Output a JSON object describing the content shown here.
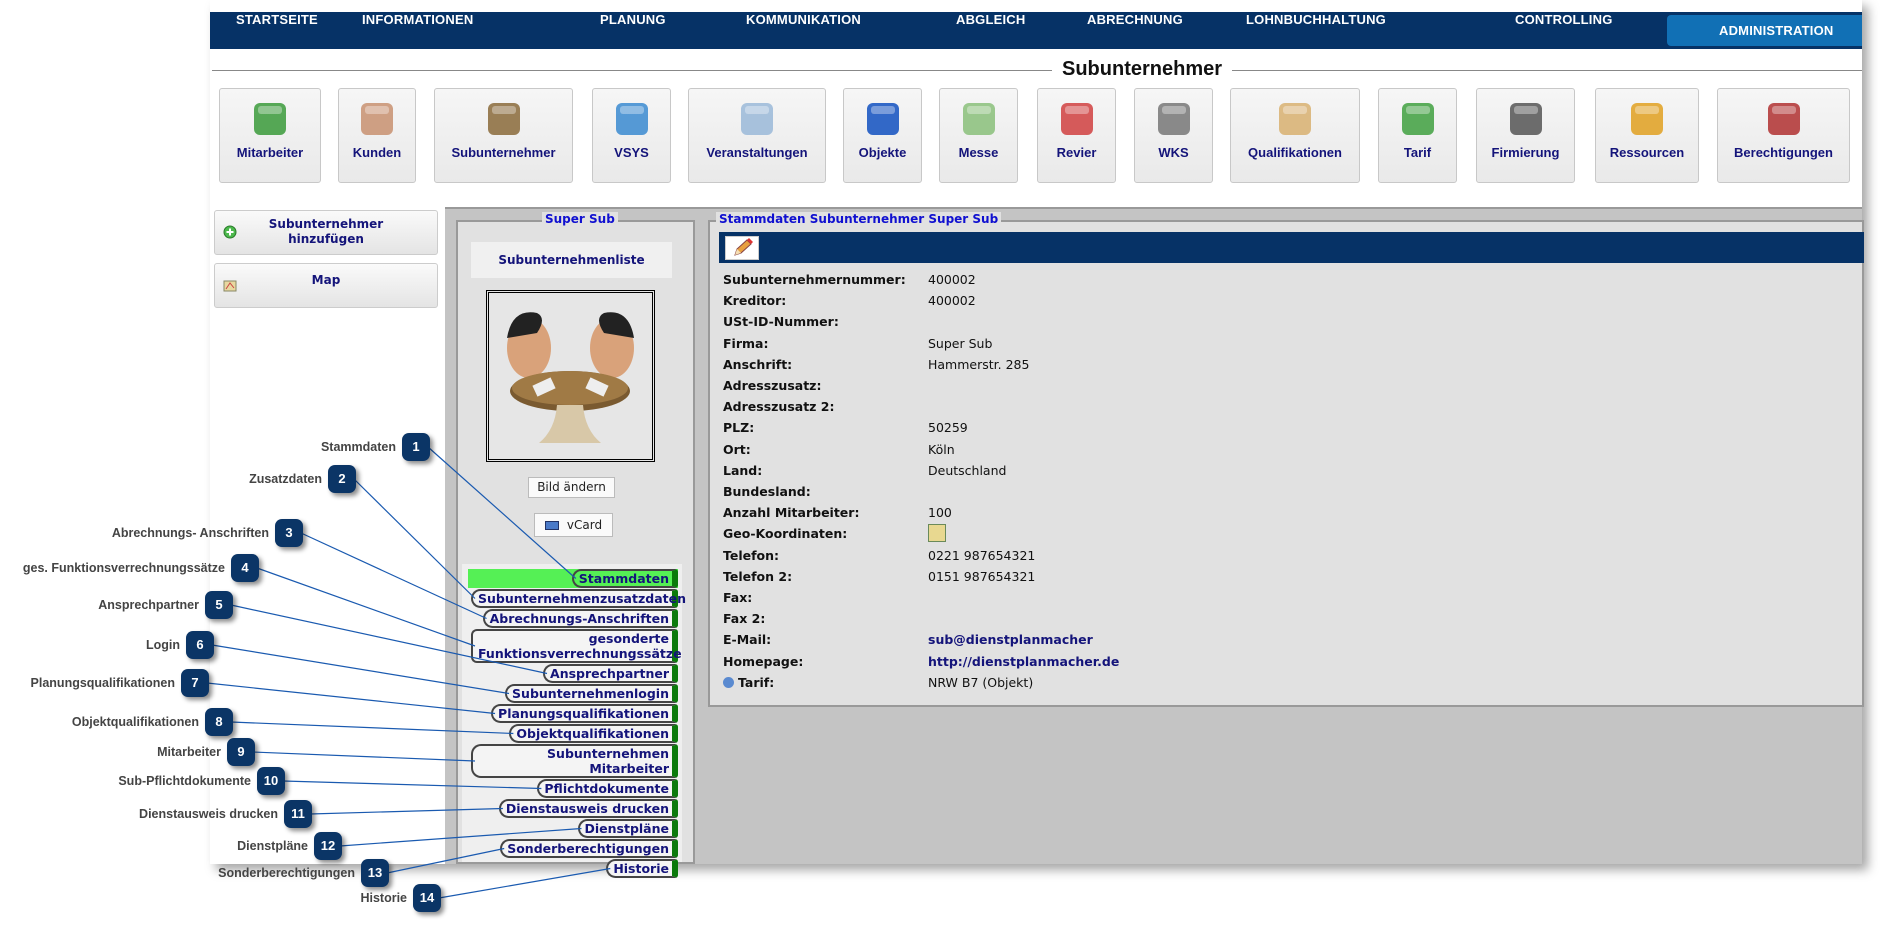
{
  "nav": {
    "items": [
      {
        "label": "STARTSEITE"
      },
      {
        "label": "INFORMATIONEN"
      },
      {
        "label": "PLANUNG"
      },
      {
        "label": "KOMMUNIKATION"
      },
      {
        "label": "ABGLEICH"
      },
      {
        "label": "ABRECHNUNG"
      },
      {
        "label": "LOHNBUCHHALTUNG"
      },
      {
        "label": "CONTROLLING"
      },
      {
        "label": "ADMINISTRATION",
        "active": true
      }
    ]
  },
  "page_title": "Subunternehmer",
  "tiles": [
    {
      "label": "Mitarbeiter",
      "icon": "people-icon",
      "color": "#3a9a3a"
    },
    {
      "label": "Kunden",
      "icon": "handshake-icon",
      "color": "#c89070"
    },
    {
      "label": "Subunternehmer",
      "icon": "meeting-table-icon",
      "color": "#8a6a3a"
    },
    {
      "label": "VSYS",
      "icon": "monitors-sync-icon",
      "color": "#3a8ad0"
    },
    {
      "label": "Veranstaltungen",
      "icon": "flowchart-icon",
      "color": "#9ab8d8"
    },
    {
      "label": "Objekte",
      "icon": "cube-icon",
      "color": "#1050c0"
    },
    {
      "label": "Messe",
      "icon": "calendar-icon",
      "color": "#8ac07a"
    },
    {
      "label": "Revier",
      "icon": "cars-map-icon",
      "color": "#d04040"
    },
    {
      "label": "WKS",
      "icon": "qr-phone-icon",
      "color": "#777777"
    },
    {
      "label": "Qualifikationen",
      "icon": "certificate-icon",
      "color": "#d8b070"
    },
    {
      "label": "Tarif",
      "icon": "document-check-gear-icon",
      "color": "#40a040"
    },
    {
      "label": "Firmierung",
      "icon": "telephone-icon",
      "color": "#555555"
    },
    {
      "label": "Ressourcen",
      "icon": "boxes-icon",
      "color": "#e0a020"
    },
    {
      "label": "Berechtigungen",
      "icon": "user-gear-icon",
      "color": "#b03030"
    }
  ],
  "sidebar": {
    "add_label": "Subunternehmer hinzufügen",
    "map_label": "Map"
  },
  "left_panel": {
    "legend": "Super Sub",
    "list_link": "Subunternehmenliste",
    "change_image": "Bild ändern",
    "vcard": "vCard",
    "menu": [
      {
        "label": "Stammdaten",
        "active": true
      },
      {
        "label": "Subunternehmenzusatzdaten"
      },
      {
        "label": "Abrechnungs-Anschriften"
      },
      {
        "label": "gesonderte Funktionsverrechnungssätze"
      },
      {
        "label": "Ansprechpartner"
      },
      {
        "label": "Subunternehmenlogin"
      },
      {
        "label": "Planungsqualifikationen"
      },
      {
        "label": "Objektqualifikationen"
      },
      {
        "label": "Subunternehmen Mitarbeiter"
      },
      {
        "label": "Pflichtdokumente"
      },
      {
        "label": "Dienstausweis drucken"
      },
      {
        "label": "Dienstpläne"
      },
      {
        "label": "Sonderberechtigungen"
      },
      {
        "label": "Historie"
      }
    ]
  },
  "details": {
    "legend": "Stammdaten Subunternehmer Super Sub",
    "rows": [
      {
        "k": "Subunternehmernummer:",
        "v": "400002"
      },
      {
        "k": "Kreditor:",
        "v": "400002"
      },
      {
        "k": "USt-ID-Nummer:",
        "v": ""
      },
      {
        "k": "Firma:",
        "v": "Super Sub"
      },
      {
        "k": "Anschrift:",
        "v": "Hammerstr. 285"
      },
      {
        "k": "Adresszusatz:",
        "v": ""
      },
      {
        "k": "Adresszusatz 2:",
        "v": ""
      },
      {
        "k": "PLZ:",
        "v": "50259"
      },
      {
        "k": "Ort:",
        "v": "Köln"
      },
      {
        "k": "Land:",
        "v": "Deutschland"
      },
      {
        "k": "Bundesland:",
        "v": ""
      },
      {
        "k": "Anzahl Mitarbeiter:",
        "v": "100"
      },
      {
        "k": "Geo-Koordinaten:",
        "v": "",
        "icon": "map-icon"
      },
      {
        "k": "Telefon:",
        "v": "0221 987654321"
      },
      {
        "k": "Telefon 2:",
        "v": "0151 987654321"
      },
      {
        "k": "Fax:",
        "v": ""
      },
      {
        "k": "Fax 2:",
        "v": ""
      },
      {
        "k": "E-Mail:",
        "v": "sub@dienstplanmacher",
        "link": true
      },
      {
        "k": "Homepage:",
        "v": "http://dienstplanmacher.de",
        "link": true
      },
      {
        "k": "Tarif:",
        "v": "NRW B7 (Objekt)",
        "info": true
      }
    ]
  },
  "annotations": [
    {
      "n": "1",
      "label": "Stammdaten"
    },
    {
      "n": "2",
      "label": "Zusatzdaten"
    },
    {
      "n": "3",
      "label": "Abrechnungs- Anschriften"
    },
    {
      "n": "4",
      "label": "ges. Funktionsverrechnungssätze"
    },
    {
      "n": "5",
      "label": "Ansprechpartner"
    },
    {
      "n": "6",
      "label": "Login"
    },
    {
      "n": "7",
      "label": "Planungsqualifikationen"
    },
    {
      "n": "8",
      "label": "Objektqualifikationen"
    },
    {
      "n": "9",
      "label": "Mitarbeiter"
    },
    {
      "n": "10",
      "label": "Sub-Pflichtdokumente"
    },
    {
      "n": "11",
      "label": "Dienstausweis drucken"
    },
    {
      "n": "12",
      "label": "Dienstpläne"
    },
    {
      "n": "13",
      "label": "Sonderberechtigungen"
    },
    {
      "n": "14",
      "label": "Historie"
    }
  ],
  "colors": {
    "nav": "#063266",
    "nav_active": "#1170b5",
    "active_menu": "#55f055",
    "callout": "#0b3566",
    "link": "#14147a"
  }
}
